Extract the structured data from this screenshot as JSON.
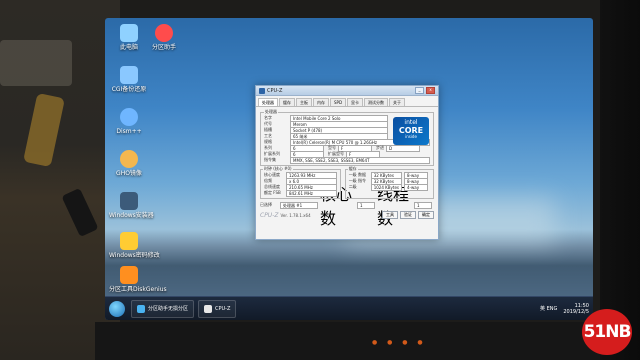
{
  "desktop_icons": [
    {
      "label": "此电脑"
    },
    {
      "label": "分区助手"
    },
    {
      "label": "CGI备份还原"
    },
    {
      "label": "Dism++"
    },
    {
      "label": "GHO镜像"
    },
    {
      "label": "Windows安装器"
    },
    {
      "label": "Windows密码修改"
    },
    {
      "label": "分区工具DiskGenius"
    }
  ],
  "window": {
    "title": "CPU-Z",
    "tabs": [
      "处理器",
      "缓存",
      "主板",
      "内存",
      "SPD",
      "显卡",
      "测试分数",
      "关于"
    ],
    "processor_group": "处理器",
    "fields": {
      "name_label": "名字",
      "name_value": "Intel Mobile Core 2 Solo",
      "code_label": "代号",
      "code_value": "Merom",
      "socket_label": "插槽",
      "socket_value": "Socket P (478)",
      "process_label": "工艺",
      "process_value": "65 纳米",
      "spec_label": "规格",
      "spec_value": "Intel(R) Celeron(R) M CPU 570 @ 1.26GHz",
      "family_label": "系列",
      "family_value": "6",
      "model_label": "型号",
      "model_value": "F",
      "stepping_label": "步进",
      "stepping_value": "D",
      "ext_family_label": "扩展系列",
      "ext_family_value": "6",
      "ext_model_label": "扩展型号",
      "ext_model_value": "F",
      "instructions_label": "指令集",
      "instructions_value": "MMX, SSE, SSE2, SSE3, SSSE3, EM64T"
    },
    "clock_group": "时钟 (核心 #0)",
    "cache_group": "缓存",
    "core_speed_label": "核心速度",
    "core_speed_value": "1263.93 MHz",
    "multiplier_label": "倍频",
    "multiplier_value": "x 6.0",
    "bus_speed_label": "总线速度",
    "bus_speed_value": "210.65 MHz",
    "rated_fsb_label": "额定 FSB",
    "rated_fsb_value": "842.61 MHz",
    "l1d_label": "一级 数据",
    "l1d_value": "32 KBytes",
    "l1d_way": "8-way",
    "l1i_label": "一级 指令",
    "l1i_value": "32 KBytes",
    "l1i_way": "8-way",
    "l2_label": "二级",
    "l2_value": "1024 KBytes",
    "l2_way": "4-way",
    "selection_label": "已选择",
    "selection_value": "处理器 #1",
    "cores_label": "核心数",
    "cores_value": "1",
    "threads_label": "线程数",
    "threads_value": "1",
    "version": "Ver. 1.78.1.x64",
    "tools_button": "工具",
    "validate_button": "验证",
    "ok_button": "确定"
  },
  "intel_badge": {
    "brand": "intel",
    "core": "CORE",
    "sub": "inside"
  },
  "taskbar": {
    "items": [
      {
        "label": "分区助手无损分区"
      },
      {
        "label": "CPU-Z"
      }
    ],
    "tray": {
      "input": "英 ENG",
      "time": "11:50",
      "date": "2019/12/5"
    }
  },
  "watermark": "51NB",
  "colors": {
    "intel_blue": "#0d78cb",
    "watermark_red": "#d51d1d",
    "taskbar": "#111a28"
  }
}
